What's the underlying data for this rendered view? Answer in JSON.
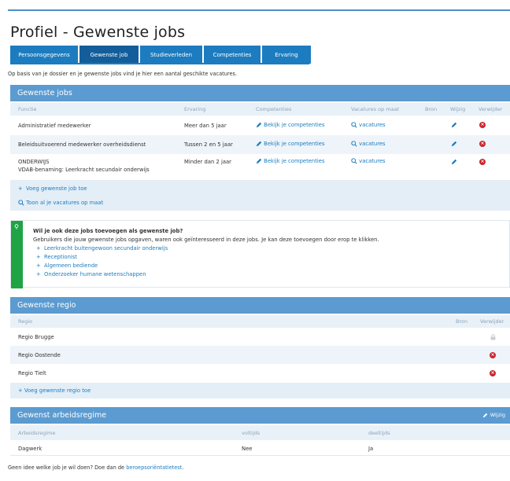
{
  "page": {
    "title": "Profiel - Gewenste jobs"
  },
  "tabs": [
    {
      "label": "Persoonsgegevens",
      "active": false
    },
    {
      "label": "Gewenste job",
      "active": true
    },
    {
      "label": "Studieverleden",
      "active": false
    },
    {
      "label": "Competenties",
      "active": false
    },
    {
      "label": "Ervaring",
      "active": false
    }
  ],
  "intro": "Op basis van je dossier en je gewenste jobs vind je hier een aantal geschikte vacatures.",
  "jobs": {
    "title": "Gewenste jobs",
    "columns": {
      "functie": "Functie",
      "ervaring": "Ervaring",
      "competenties": "Competenties",
      "vacatures": "Vacatures op maat",
      "bron": "Bron",
      "wijzig": "Wijzig",
      "verwijder": "Verwijder"
    },
    "rows": [
      {
        "functie": "Administratief medewerker",
        "functie2": "",
        "ervaring": "Meer dan 5 jaar",
        "competenties": "Bekijk je competenties",
        "vacatures": "vacatures"
      },
      {
        "functie": "Beleidsuitvoerend medewerker overheidsdienst",
        "functie2": "",
        "ervaring": "Tussen 2 en 5 jaar",
        "competenties": "Bekijk je competenties",
        "vacatures": "vacatures"
      },
      {
        "functie": "ONDERWIJS",
        "functie2": "VDAB-benaming: Leerkracht secundair onderwijs",
        "ervaring": "Minder dan 2 jaar",
        "competenties": "Bekijk je competenties",
        "vacatures": "vacatures"
      }
    ],
    "add_label": "Voeg gewenste job toe",
    "all_vacatures_label": "Toon al je vacatures op maat"
  },
  "suggest": {
    "question": "Wil je ook deze jobs toevoegen als gewenste job?",
    "text": "Gebruikers die jouw gewenste jobs opgaven, waren ook geïnteresseerd in deze jobs. Je kan deze toevoegen door erop te klikken.",
    "items": [
      "Leerkracht buitengewoon secundair onderwijs",
      "Receptionist",
      "Algemeen bediende",
      "Onderzoeker humane wetenschappen"
    ]
  },
  "regio": {
    "title": "Gewenste regio",
    "columns": {
      "regio": "Regio",
      "bron": "Bron",
      "verwijder": "Verwijder"
    },
    "rows": [
      {
        "name": "Regio Brugge",
        "deletable": false
      },
      {
        "name": "Regio Oostende",
        "deletable": true
      },
      {
        "name": "Regio Tielt",
        "deletable": true
      }
    ],
    "add_label": "Voeg gewenste regio toe"
  },
  "regime": {
    "title": "Gewenst arbeidsregime",
    "edit_label": "Wijzig",
    "columns": {
      "regime": "Arbeidsregime",
      "voltijds": "voltijds",
      "deeltijds": "deeltijds"
    },
    "row": {
      "regime": "Dagwerk",
      "voltijds": "Nee",
      "deeltijds": "Ja"
    }
  },
  "footer": {
    "text": "Geen idee welke job je wil doen? Doe dan de ",
    "link": "beroepsoriëntatietest",
    "end": "."
  },
  "colors": {
    "tab": "#1c7cbf",
    "tab_active": "#135e9a",
    "panel_head": "#5b9bd1",
    "delete": "#c9262e",
    "suggest_bar": "#1fa344"
  }
}
